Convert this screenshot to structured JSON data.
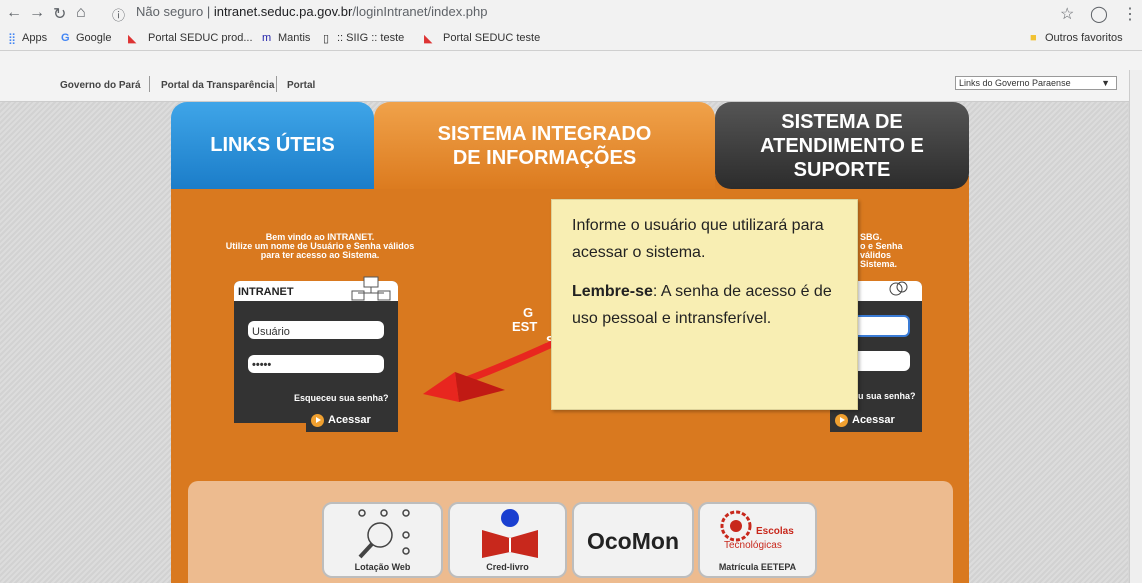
{
  "browser": {
    "url_prefix": "Não seguro",
    "url_host": "intranet.seduc.pa.gov.br",
    "url_path": "/loginIntranet/index.php",
    "bookmarks": [
      "Apps",
      "Google",
      "Portal SEDUC prod...",
      "Mantis",
      ":: SIIG :: teste",
      "Portal SEDUC teste"
    ],
    "other_bookmarks": "Outros favoritos"
  },
  "topnav": {
    "links": [
      "Governo do Pará",
      "Portal da Transparência",
      "Portal"
    ],
    "select_value": "Links do Governo Paraense"
  },
  "tabs": {
    "links": "LINKS ÚTEIS",
    "sistema_line1": "SISTEMA INTEGRADO",
    "sistema_line2": "DE INFORMAÇÕES",
    "suporte_line1": "SISTEMA DE",
    "suporte_line2": "ATENDIMENTO E",
    "suporte_line3": "SUPORTE"
  },
  "intranet": {
    "welcome_line1": "Bem vindo ao INTRANET.",
    "welcome_line2": "Utilize um nome de Usuário e Senha válidos",
    "welcome_line3": "para ter acesso ao Sistema.",
    "title": "INTRANET",
    "user_value": "Usuário",
    "password_value": "•••••",
    "forgot": "Esqueceu sua senha?",
    "login_button": "Acessar"
  },
  "sbg": {
    "welcome_line1": "SBG.",
    "welcome_line2": "o e Senha válidos",
    "welcome_line3": "Sistema.",
    "forgot": "u sua senha?",
    "login_button": "Acessar"
  },
  "mid": {
    "line1": "G",
    "line2": "EST",
    "line3": "S"
  },
  "tooltip": {
    "para1": "Informe o usuário que utilizará para acessar o sistema.",
    "para2_bold": "Lembre-se",
    "para2_rest": ": A senha de acesso é de uso pessoal e intransferível."
  },
  "cards": [
    "Lotação Web",
    "Cred-livro",
    "OcoMon",
    "Matrícula EETEPA"
  ],
  "cards_extra": {
    "escolas": "Escolas",
    "tecnologicas": "Tecnológicas"
  },
  "colors": {
    "orange": "#d9791f",
    "blue": "#1b7dc9",
    "dark": "#2c2c2c",
    "tooltip": "#f8eeb3"
  }
}
